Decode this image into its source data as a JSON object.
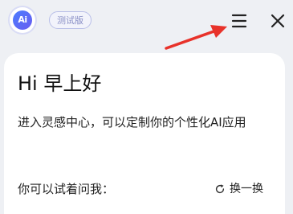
{
  "header": {
    "logo_text": "Ai",
    "version_badge": "测试版",
    "menu_icon": "hamburger-menu-icon",
    "close_icon": "close-icon"
  },
  "annotation": {
    "arrow_color": "#e8322a"
  },
  "card": {
    "greeting": "Hi 早上好",
    "intro": "进入灵感中心，可以定制你的个性化AI应用",
    "prompt_label": "你可以试着问我：",
    "refresh_label": "换一换",
    "refresh_icon": "refresh-icon"
  },
  "colors": {
    "page_background": "#eef0f4",
    "card_background": "#ffffff",
    "logo_gradient_start": "#4a7dff",
    "logo_gradient_end": "#6a5cf0",
    "badge_text": "#8a90c6"
  }
}
